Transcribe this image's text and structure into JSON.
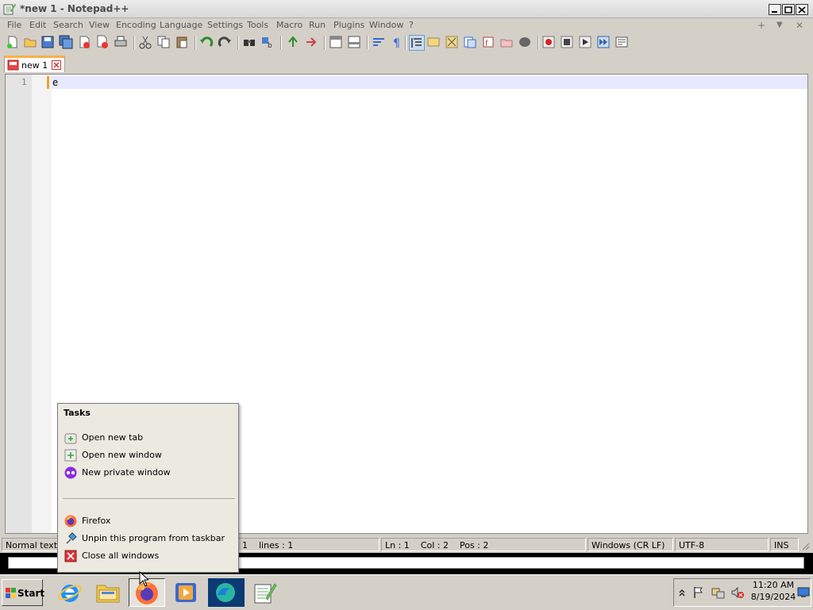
{
  "window": {
    "title": "*new 1 - Notepad++"
  },
  "menu": [
    "File",
    "Edit",
    "Search",
    "View",
    "Encoding",
    "Language",
    "Settings",
    "Tools",
    "Macro",
    "Run",
    "Plugins",
    "Window",
    "?"
  ],
  "menu_right": [
    "+",
    "▼",
    "✕"
  ],
  "tab": {
    "label": "new 1"
  },
  "editor": {
    "line_number": "1",
    "content": "e"
  },
  "statusbar": {
    "type": "Normal text fi",
    "length": "1",
    "lines": "lines : 1",
    "ln": "Ln : 1",
    "col": "Col : 2",
    "pos": "Pos : 2",
    "eol": "Windows (CR LF)",
    "encoding": "UTF-8",
    "mode": "INS"
  },
  "jumplist": {
    "heading": "Tasks",
    "tasks": [
      "Open new tab",
      "Open new window",
      "New private window"
    ],
    "program": "Firefox",
    "unpin": "Unpin this program from taskbar",
    "close_all": "Close all windows"
  },
  "taskbar": {
    "start_label": "Start",
    "time": "11:20 AM",
    "date": "8/19/2024"
  }
}
